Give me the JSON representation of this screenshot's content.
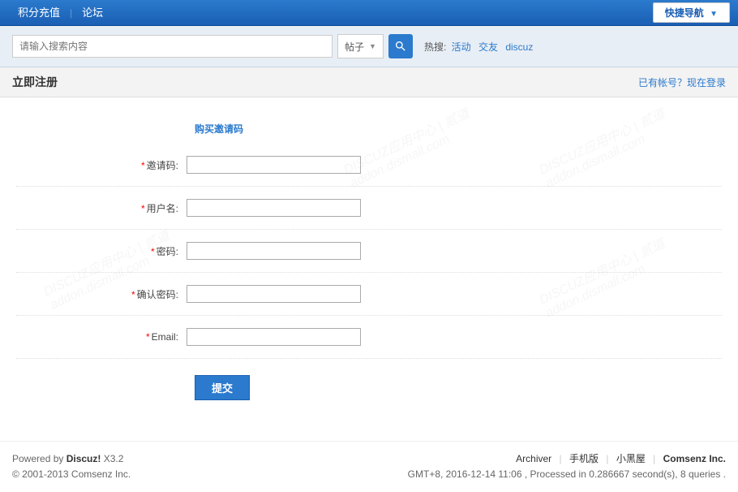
{
  "topnav": {
    "credit_recharge": "积分充值",
    "forum": "论坛",
    "quicknav": "快捷导航"
  },
  "search": {
    "placeholder": "请输入搜索内容",
    "select_label": "帖子",
    "hot_label": "热搜:",
    "hot_links": [
      "活动",
      "交友",
      "discuz"
    ]
  },
  "page": {
    "title": "立即注册",
    "login_prompt": "已有帐号？现在登录"
  },
  "form": {
    "buy_invite": "购买邀请码",
    "invite_code_label": "邀请码:",
    "username_label": "用户名:",
    "password_label": "密码:",
    "confirm_password_label": "确认密码:",
    "email_label": "Email:",
    "submit": "提交"
  },
  "footer": {
    "powered_by": "Powered by ",
    "discuz": "Discuz!",
    "version": " X3.2",
    "copyright": "© 2001-2013 Comsenz Inc.",
    "archiver": "Archiver",
    "mobile": "手机版",
    "blacklist": "小黑屋",
    "comsenz": "Comsenz Inc.",
    "timezone": "GMT+8, 2016-12-14 11:06 , Processed in 0.286667 second(s), 8 queries ."
  }
}
